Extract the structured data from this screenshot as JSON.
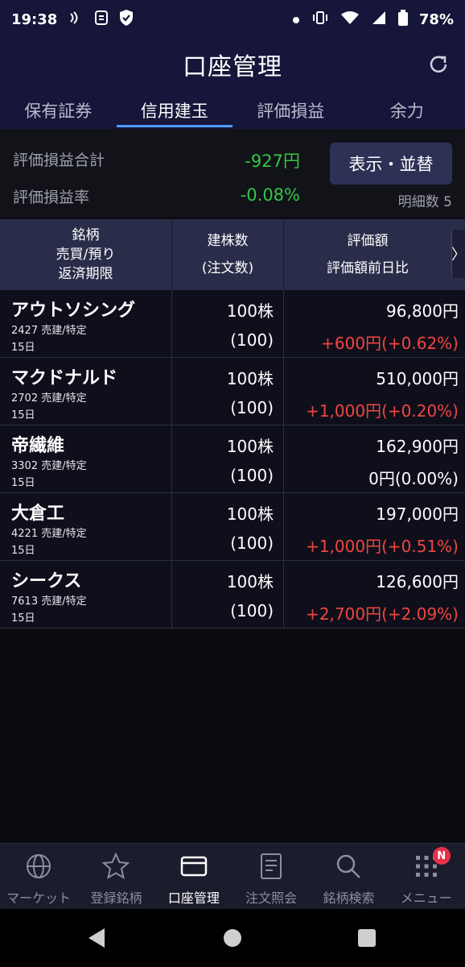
{
  "status_bar": {
    "time": "19:38",
    "battery": "78%"
  },
  "header": {
    "title": "口座管理"
  },
  "tabs": [
    {
      "label": "保有証券"
    },
    {
      "label": "信用建玉"
    },
    {
      "label": "評価損益"
    },
    {
      "label": "余力"
    }
  ],
  "summary": {
    "total_label": "評価損益合計",
    "total_value": "-927円",
    "rate_label": "評価損益率",
    "rate_value": "-0.08%",
    "sort_button": "表示・並替",
    "detail_count": "明細数 5"
  },
  "table": {
    "headers": {
      "col1": [
        "銘柄",
        "売買/預り",
        "返済期限"
      ],
      "col2": [
        "建株数",
        "(注文数)"
      ],
      "col3": [
        "評価額",
        "評価額前日比"
      ],
      "more": "〉"
    },
    "rows": [
      {
        "name": "アウトソシング",
        "code_type": "2427 売建/特定",
        "deadline": "15日",
        "qty": "100株",
        "order_qty": "(100)",
        "value": "96,800円",
        "change": "+600円(+0.62%)"
      },
      {
        "name": "マクドナルド",
        "code_type": "2702 売建/特定",
        "deadline": "15日",
        "qty": "100株",
        "order_qty": "(100)",
        "value": "510,000円",
        "change": "+1,000円(+0.20%)"
      },
      {
        "name": "帝繊維",
        "code_type": "3302 売建/特定",
        "deadline": "15日",
        "qty": "100株",
        "order_qty": "(100)",
        "value": "162,900円",
        "change": "0円(0.00%)"
      },
      {
        "name": "大倉工",
        "code_type": "4221 売建/特定",
        "deadline": "15日",
        "qty": "100株",
        "order_qty": "(100)",
        "value": "197,000円",
        "change": "+1,000円(+0.51%)"
      },
      {
        "name": "シークス",
        "code_type": "7613 売建/特定",
        "deadline": "15日",
        "qty": "100株",
        "order_qty": "(100)",
        "value": "126,600円",
        "change": "+2,700円(+2.09%)"
      }
    ]
  },
  "bottom_nav": [
    {
      "label": "マーケット",
      "icon": "globe-icon"
    },
    {
      "label": "登録銘柄",
      "icon": "star-icon"
    },
    {
      "label": "口座管理",
      "icon": "card-icon"
    },
    {
      "label": "注文照会",
      "icon": "document-icon"
    },
    {
      "label": "銘柄検索",
      "icon": "search-icon"
    },
    {
      "label": "メニュー",
      "icon": "grid-menu-icon",
      "badge": "N"
    }
  ],
  "colors": {
    "header_bg": "#16163a",
    "positive": "#f0463e",
    "summary_value": "#31c845",
    "tab_underline": "#4f9bff",
    "badge": "#e8304a"
  }
}
